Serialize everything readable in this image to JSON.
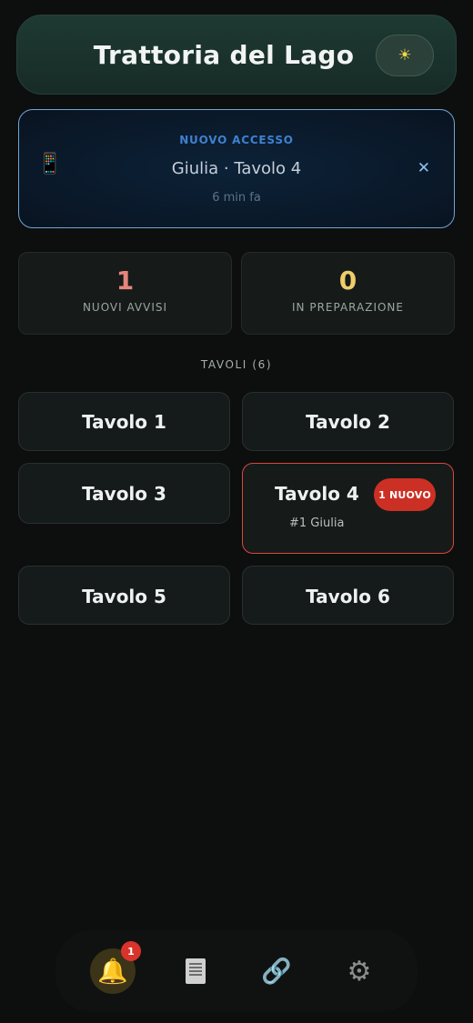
{
  "header": {
    "title": "Trattoria del Lago",
    "theme_icon": "sun-icon",
    "theme_glyph": "☀"
  },
  "notice": {
    "kicker": "NUOVO ACCESSO",
    "icon": "phone-icon",
    "phone_glyph": "📱",
    "text": "Giulia · Tavolo 4",
    "time": "6 min fa",
    "close_glyph": "✕"
  },
  "stats": [
    {
      "value": "1",
      "label": "NUOVI AVVISI",
      "color": "#e5867d"
    },
    {
      "value": "0",
      "label": "IN PREPARAZIONE",
      "color": "#f0cd6b"
    }
  ],
  "section": {
    "label": "TAVOLI (6)"
  },
  "tables": [
    {
      "name": "Tavolo 1"
    },
    {
      "name": "Tavolo 2"
    },
    {
      "name": "Tavolo 3"
    },
    {
      "name": "Tavolo 4",
      "badge": "1 NUOVO",
      "sub": "#1 Giulia"
    },
    {
      "name": "Tavolo 5"
    },
    {
      "name": "Tavolo 6"
    }
  ],
  "nav": {
    "items": [
      {
        "icon": "bell-icon",
        "glyph": "🔔",
        "badge": "1",
        "active": true
      },
      {
        "icon": "receipt-icon"
      },
      {
        "icon": "link-icon",
        "glyph": "🔗"
      },
      {
        "icon": "gear-icon",
        "glyph": "⚙"
      }
    ]
  },
  "colors": {
    "accent_blue": "#3f80cf",
    "alert_red": "#cc3024",
    "header_green": "#1d3a32"
  }
}
